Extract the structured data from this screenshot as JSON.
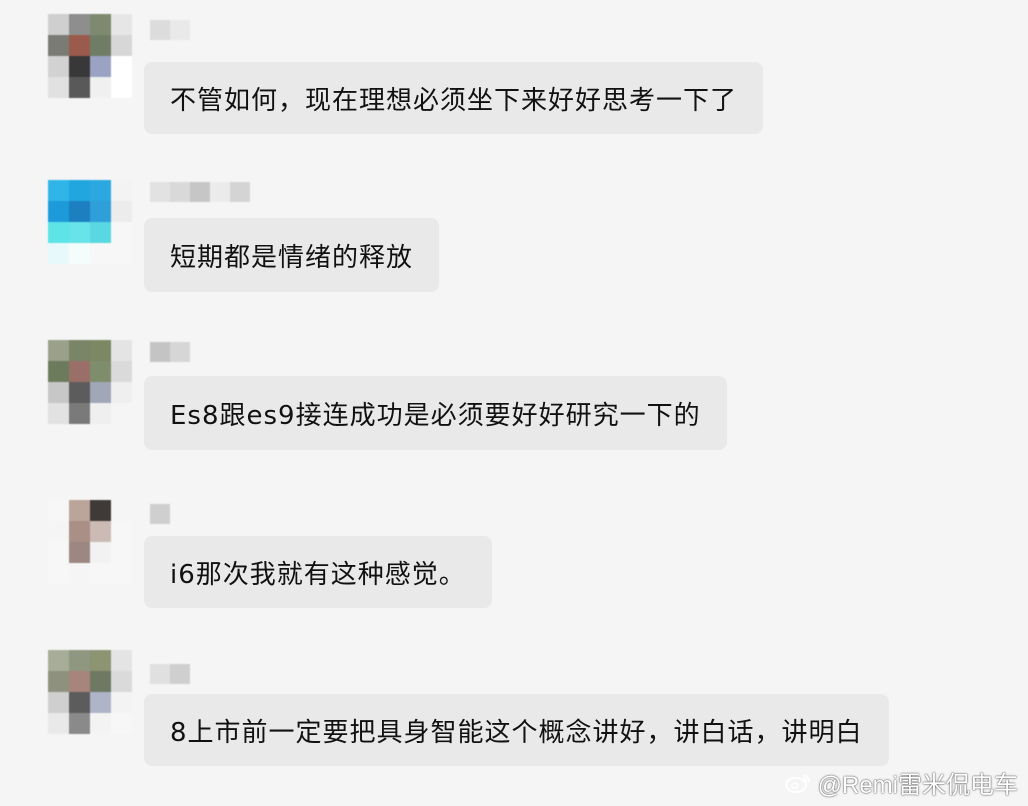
{
  "messages": [
    {
      "text": "不管如何，现在理想必须坐下来好好思考一下了"
    },
    {
      "text": "短期都是情绪的释放"
    },
    {
      "text": "Es8跟es9接连成功是必须要好好研究一下的"
    },
    {
      "text": "i6那次我就有这种感觉。"
    },
    {
      "text": "8上市前一定要把具身智能这个概念讲好，讲白话，讲明白"
    }
  ],
  "watermark": {
    "text": "@Remi雷米侃电车",
    "icon": "weibo-icon"
  },
  "colors": {
    "background": "#f5f5f5",
    "bubble": "#e9e9e9",
    "text": "#111111"
  }
}
